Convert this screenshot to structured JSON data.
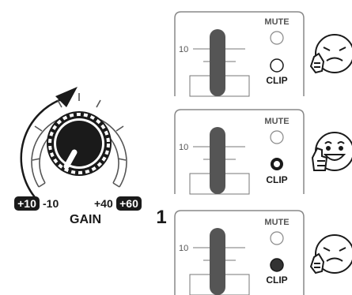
{
  "gain": {
    "label": "GAIN",
    "badge_left": "+10",
    "tick_left": "-10",
    "tick_right": "+40",
    "badge_right": "+60"
  },
  "step_number": "1",
  "panels": [
    {
      "mute_label": "MUTE",
      "clip_label": "CLIP",
      "scale_label": "10",
      "clip_state": "off",
      "face": "frown"
    },
    {
      "mute_label": "MUTE",
      "clip_label": "CLIP",
      "scale_label": "10",
      "clip_state": "ring",
      "face": "smile"
    },
    {
      "mute_label": "MUTE",
      "clip_label": "CLIP",
      "scale_label": "10",
      "clip_state": "lit",
      "face": "frown"
    }
  ],
  "colors": {
    "ink": "#1a1a1a",
    "panel_stroke": "#888888",
    "fader": "#555555"
  }
}
